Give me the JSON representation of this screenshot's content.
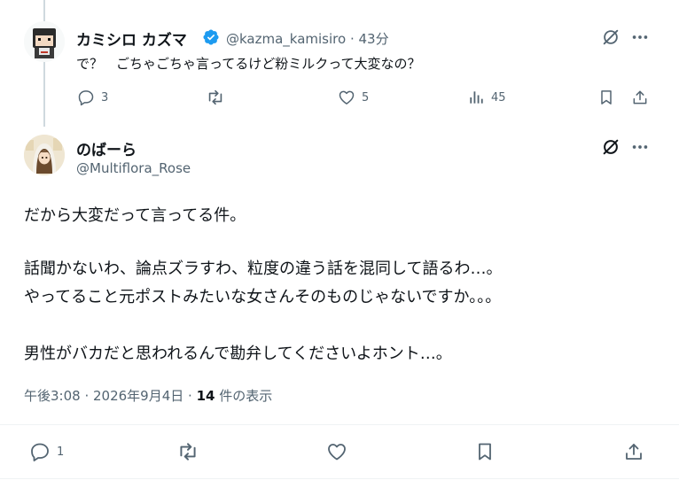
{
  "reply_parent": {
    "display_name": "カミシロ カズマ",
    "handle": "@kazma_kamisiro",
    "time": "43分",
    "text": "で？　ごちゃごちゃ言ってるけど粉ミルクって大変なの？",
    "verified": true,
    "actions": {
      "replies": "3",
      "reposts": "",
      "likes": "5",
      "views": "45"
    }
  },
  "main_post": {
    "display_name": "のばーら",
    "handle": "@Multiflora_Rose",
    "lines": [
      "だから大変だって言ってる件。",
      "話聞かないわ、論点ズラすわ、粒度の違う話を混同して語るわ…。",
      "やってること元ポストみたいな女さんそのものじゃないですか。。。",
      "男性がバカだと思われるんで勘弁してくださいよホント…。"
    ],
    "timestamp": "午後3:08 · 2026年9月4日",
    "view_count": "14",
    "view_suffix": "件の表示",
    "actions": {
      "replies": "1"
    }
  },
  "colors": {
    "text": "#0f1419",
    "secondary": "#536471",
    "verified": "#1d9bf0",
    "divider": "#eff3f4"
  }
}
